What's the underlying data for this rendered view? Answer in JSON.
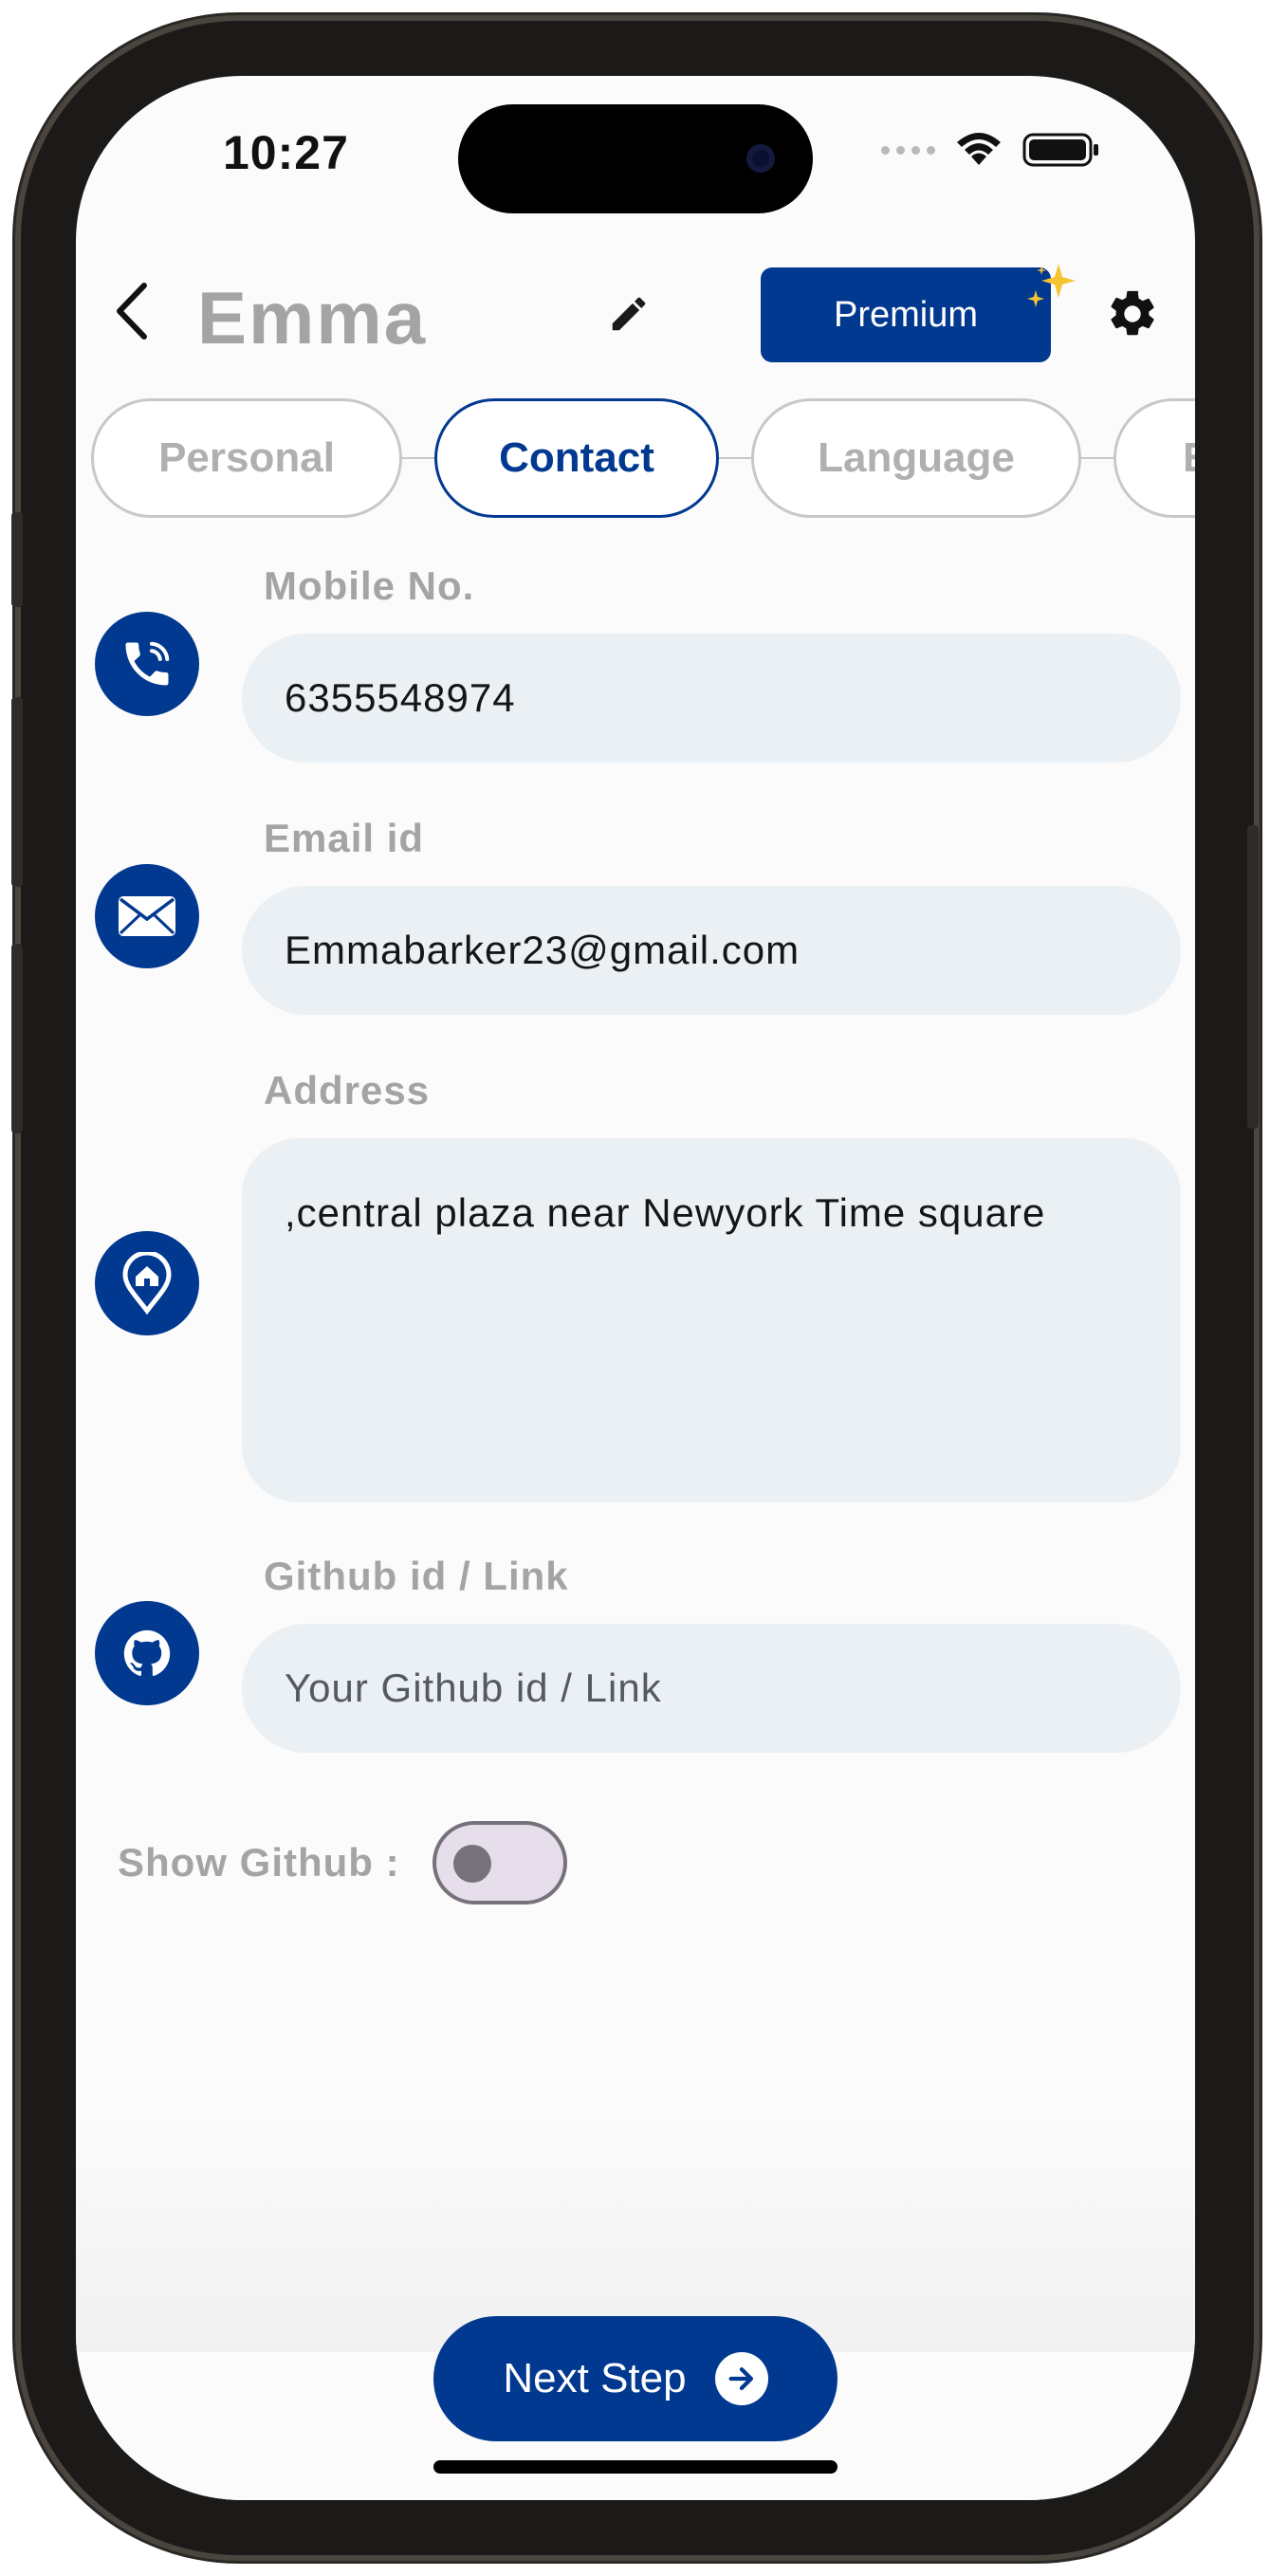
{
  "status_bar": {
    "time": "10:27"
  },
  "header": {
    "title": "Emma",
    "premium_label": "Premium"
  },
  "tabs": [
    {
      "label": "Personal",
      "active": false
    },
    {
      "label": "Contact",
      "active": true
    },
    {
      "label": "Language",
      "active": false
    },
    {
      "label": "E",
      "active": false
    }
  ],
  "fields": {
    "mobile": {
      "label": "Mobile No.",
      "value": "6355548974"
    },
    "email": {
      "label": "Email id",
      "value": "Emmabarker23@gmail.com"
    },
    "address": {
      "label": "Address",
      "value": ",central plaza near Newyork Time square"
    },
    "github": {
      "label": "Github id / Link",
      "placeholder": "Your Github id / Link"
    }
  },
  "toggle": {
    "label": "Show Github :",
    "on": false
  },
  "footer": {
    "next_label": "Next Step"
  },
  "colors": {
    "accent": "#023990",
    "input_bg": "#ebf0f4",
    "muted_text": "#a4a4a4"
  }
}
